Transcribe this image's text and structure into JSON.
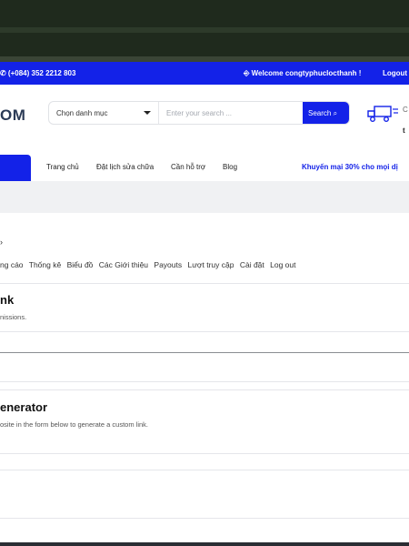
{
  "topbar": {
    "phone": "✆ (+084) 352 2212 803",
    "welcome": "⎆ Welcome congtyphuclocthanh !",
    "logout": "Logout"
  },
  "header": {
    "logo_text": "OM",
    "category_select": "Chọn danh mục",
    "search_placeholder": "Enter your search ...",
    "search_button": "Search ⌕",
    "truck_line1": "C",
    "truck_line2": "t"
  },
  "nav": {
    "items": [
      "Trang chủ",
      "Đặt lịch sửa chữa",
      "Cần hỗ trợ",
      "Blog"
    ],
    "promo": "Khuyến mại 30% cho mọi dị"
  },
  "account": {
    "caret": "›",
    "tabs": [
      "ng cáo",
      "Thống kê",
      "Biểu đồ",
      "Các Giới thiệu",
      "Payouts",
      "Lượt truy cập",
      "Cài đặt",
      "Log out"
    ]
  },
  "sections": {
    "link_title": "nk",
    "link_sub": "nissions.",
    "generator_title": "enerator",
    "generator_sub": "osite in the form below to generate a custom link."
  },
  "colors": {
    "brand_blue": "#1322e8",
    "logo_navy": "#2b3b56"
  }
}
